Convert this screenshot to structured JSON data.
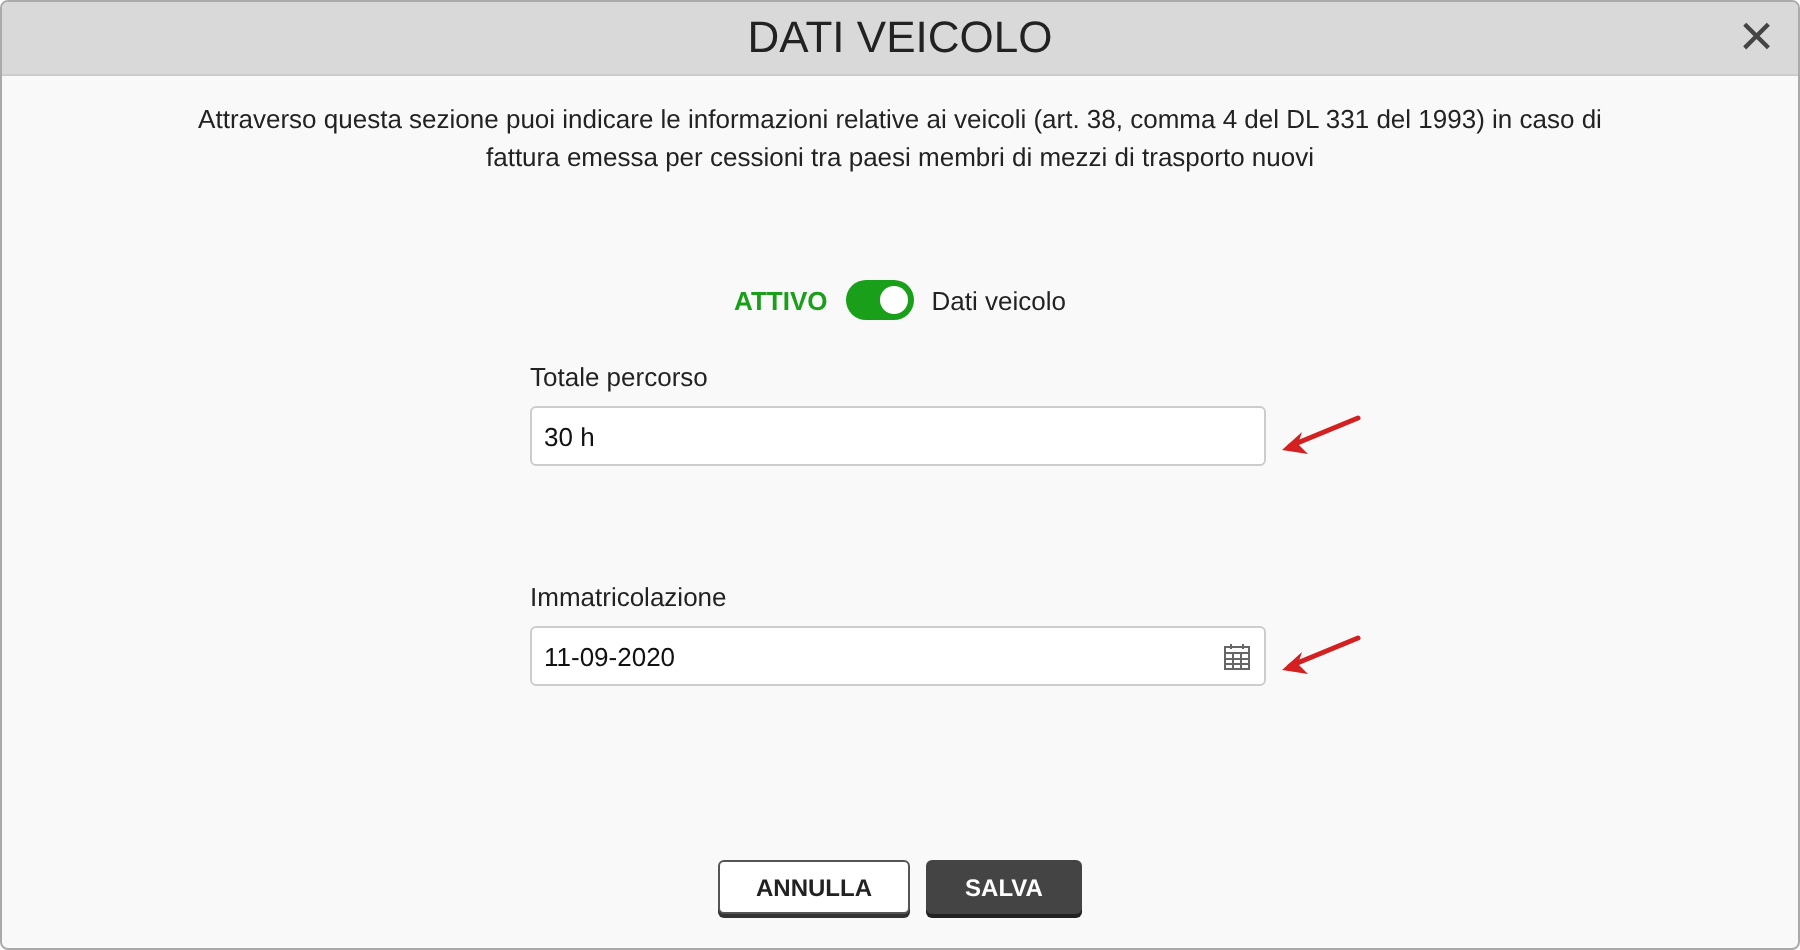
{
  "window": {
    "title": "DATI VEICOLO",
    "close": "×"
  },
  "description": "Attraverso questa sezione puoi indicare le informazioni relative ai veicoli (art. 38, comma 4 del DL 331 del 1993) in caso di fattura emessa per cessioni tra paesi membri di mezzi di trasporto nuovi",
  "toggle": {
    "status": "ATTIVO",
    "on": true,
    "label": "Dati veicolo"
  },
  "fields": [
    {
      "kind": "text",
      "label": "Totale percorso",
      "value": "30 h",
      "marked": true
    },
    {
      "kind": "date",
      "label": "Immatricolazione",
      "value": "11-09-2020",
      "marked": true
    }
  ],
  "buttons": [
    {
      "kind": "secondary",
      "label": "ANNULLA"
    },
    {
      "kind": "primary",
      "label": "SALVA"
    }
  ]
}
